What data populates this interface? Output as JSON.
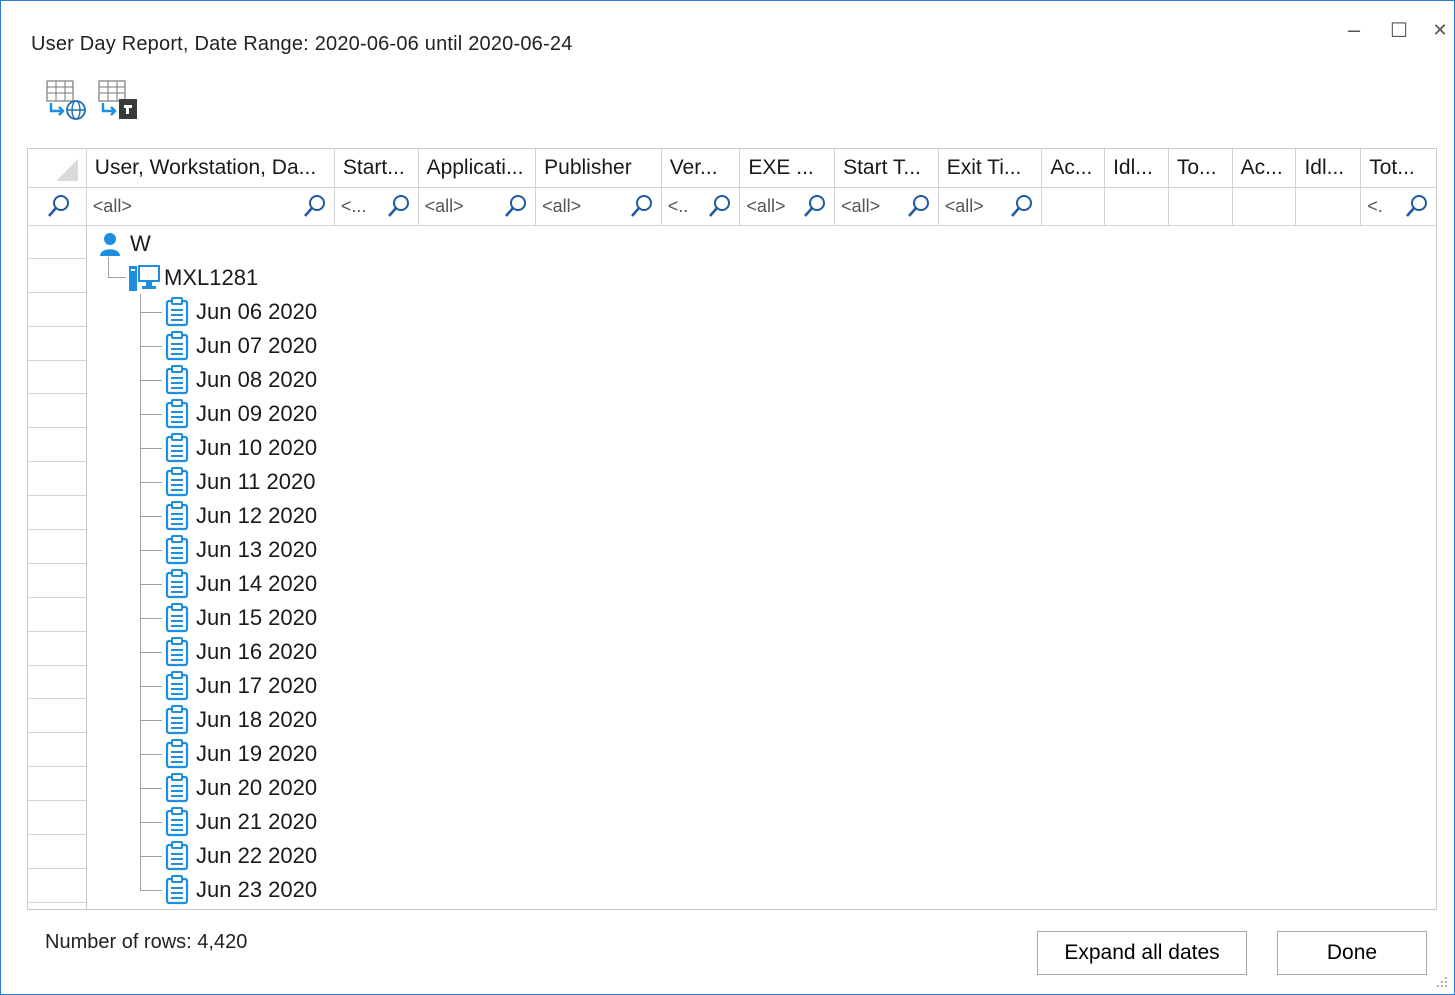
{
  "window": {
    "title": "User Day Report, Date Range: 2020-06-06 until 2020-06-24",
    "minimize_glyph": "–",
    "maximize_glyph": "☐",
    "close_glyph": "✕"
  },
  "toolbar": {
    "icons": [
      "export-web-icon",
      "export-file-icon"
    ]
  },
  "grid": {
    "columns": [
      {
        "label": "User, Workstation, Da...",
        "filter": "<all>"
      },
      {
        "label": "Start...",
        "filter": "<..."
      },
      {
        "label": "Applicati...",
        "filter": "<all>"
      },
      {
        "label": "Publisher",
        "filter": "<all>"
      },
      {
        "label": "Ver...",
        "filter": "<.."
      },
      {
        "label": "EXE ...",
        "filter": "<all>"
      },
      {
        "label": "Start T...",
        "filter": "<all>"
      },
      {
        "label": "Exit Ti...",
        "filter": "<all>"
      },
      {
        "label": "Ac...",
        "filter": ""
      },
      {
        "label": "Idl...",
        "filter": ""
      },
      {
        "label": "To...",
        "filter": ""
      },
      {
        "label": "Ac...",
        "filter": ""
      },
      {
        "label": "Idl...",
        "filter": ""
      },
      {
        "label": "Tot...",
        "filter": "<."
      }
    ],
    "tree": {
      "user": "W",
      "workstation": "MXL1281",
      "dates": [
        "Jun 06 2020",
        "Jun 07 2020",
        "Jun 08 2020",
        "Jun 09 2020",
        "Jun 10 2020",
        "Jun 11 2020",
        "Jun 12 2020",
        "Jun 13 2020",
        "Jun 14 2020",
        "Jun 15 2020",
        "Jun 16 2020",
        "Jun 17 2020",
        "Jun 18 2020",
        "Jun 19 2020",
        "Jun 20 2020",
        "Jun 21 2020",
        "Jun 22 2020",
        "Jun 23 2020"
      ]
    }
  },
  "footer": {
    "row_count": "Number of rows: 4,420",
    "expand_label": "Expand all dates",
    "done_label": "Done"
  },
  "colors": {
    "accent": "#2b7bd6",
    "icon_blue": "#1e8fe0"
  }
}
